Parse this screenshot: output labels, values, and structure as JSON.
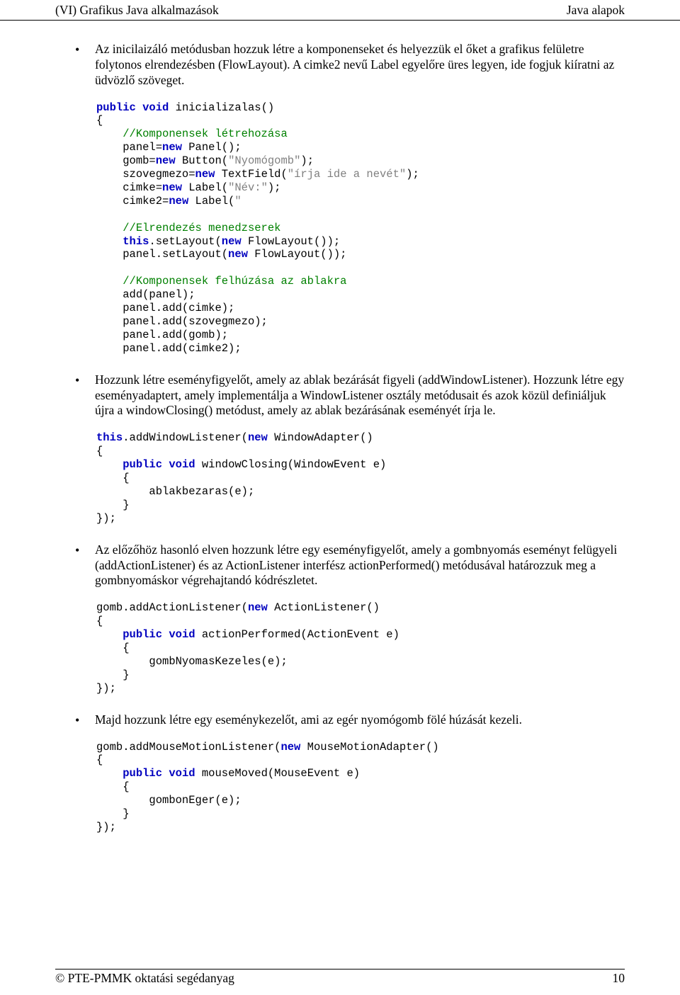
{
  "header": {
    "left": "(VI) Grafikus Java alkalmazások",
    "right": "Java alapok"
  },
  "bullets": {
    "b1": "Az inicilaizáló metódusban hozzuk létre a komponenseket és helyezzük el őket a grafikus felületre folytonos elrendezésben (FlowLayout). A cimke2 nevű Label egyelőre üres legyen, ide fogjuk kiíratni az üdvözlő szöveget.",
    "b2": "Hozzunk létre eseményfigyelőt, amely az ablak bezárását figyeli (addWindowListener). Hozzunk létre egy eseményadaptert, amely implementálja a WindowListener osztály metódusait és azok közül definiáljuk újra a windowClosing() metódust, amely az ablak bezárásának eseményét írja le.",
    "b3": "Az előzőhöz hasonló elven hozzunk létre egy eseményfigyelőt, amely a gombnyomás eseményt felügyeli (addActionListener) és az ActionListener interfész actionPerformed() metódusával határozzuk meg a gombnyomáskor végrehajtandó kódrészletet.",
    "b4": "Majd hozzunk létre egy eseménykezelőt, ami az egér nyomógomb fölé húzását kezeli."
  },
  "code1": {
    "kw_public": "public",
    "kw_void": "void",
    "fn": " inicializalas()",
    "l2": "{",
    "cm1": "//Komponensek létrehozása",
    "p1a": "panel=",
    "kw_new1": "new",
    "p1b": " Panel();",
    "p2a": "gomb=",
    "kw_new2": "new",
    "p2b": " Button(",
    "str1": "\"Nyomógomb\"",
    "p2c": ");",
    "p3a": "szovegmezo=",
    "kw_new3": "new",
    "p3b": " TextField(",
    "str2": "\"írja ide a nevét\"",
    "p3c": ");",
    "p4a": "cimke=",
    "kw_new4": "new",
    "p4b": " Label(",
    "str3": "\"Név:\"",
    "p4c": ");",
    "p5a": "cimke2=",
    "kw_new5": "new",
    "p5b": " Label(",
    "str4": "\"                                                                       \"",
    "p5c": ");",
    "cm2": "//Elrendezés menedzserek",
    "kw_this1": "this",
    "p6a": ".setLayout(",
    "kw_new6": "new",
    "p6b": " FlowLayout());",
    "p7a": "panel.setLayout(",
    "kw_new7": "new",
    "p7b": " FlowLayout());",
    "cm3": "//Komponensek felhúzása az ablakra",
    "p8": "add(panel);",
    "p9": "panel.add(cimke);",
    "p10": "panel.add(szovegmezo);",
    "p11": "panel.add(gomb);",
    "p12": "panel.add(cimke2);"
  },
  "code2": {
    "kw_this": "this",
    "l1a": ".addWindowListener(",
    "kw_new": "new",
    "l1b": " WindowAdapter()",
    "l2": "{",
    "kw_public": "public",
    "kw_void": "void",
    "fn": " windowClosing(WindowEvent e)",
    "l4": "{",
    "l5": "ablakbezaras(e);",
    "l6": "}",
    "l7": "});"
  },
  "code3": {
    "l1a": "gomb.addActionListener(",
    "kw_new": "new",
    "l1b": " ActionListener()",
    "l2": "{",
    "kw_public": "public",
    "kw_void": "void",
    "fn": " actionPerformed(ActionEvent e)",
    "l4": "{",
    "l5": "gombNyomasKezeles(e);",
    "l6": "}",
    "l7": "});"
  },
  "code4": {
    "l1a": "gomb.addMouseMotionListener(",
    "kw_new": "new",
    "l1b": " MouseMotionAdapter()",
    "l2": "{",
    "kw_public": "public",
    "kw_void": "void",
    "fn": " mouseMoved(MouseEvent e)",
    "l4": "{",
    "l5": "gombonEger(e);",
    "l6": "}",
    "l7": "});"
  },
  "footer": {
    "left": "© PTE-PMMK oktatási segédanyag",
    "right": "10"
  }
}
